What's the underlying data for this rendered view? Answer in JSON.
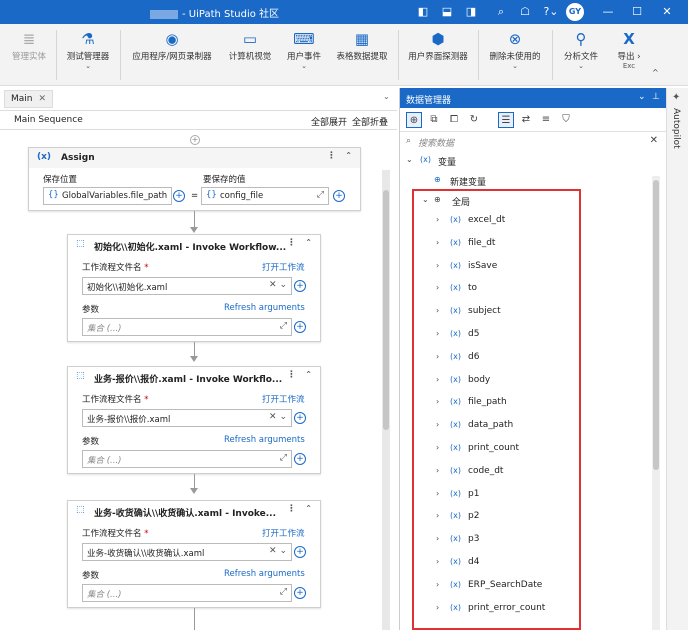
{
  "titlebar": {
    "title": "- UiPath Studio 社区",
    "avatar": "GY"
  },
  "ribbon": {
    "items": [
      {
        "label": "管理实体",
        "icon": "≣",
        "disabled": true,
        "chevron": ""
      },
      {
        "label": "测试管理器",
        "icon": "⚗",
        "disabled": false,
        "chevron": "⌄"
      },
      {
        "label": "应用程序/网页录制器",
        "icon": "◉",
        "disabled": false,
        "chevron": ""
      },
      {
        "label": "计算机视觉",
        "icon": "▭",
        "disabled": false,
        "chevron": ""
      },
      {
        "label": "用户事件",
        "icon": "⌨",
        "disabled": false,
        "chevron": "⌄"
      },
      {
        "label": "表格数据提取",
        "icon": "▦",
        "disabled": false,
        "chevron": ""
      },
      {
        "label": "用户界面探测器",
        "icon": "⬢",
        "disabled": false,
        "chevron": ""
      },
      {
        "label": "删除未使用的",
        "icon": "⊗",
        "disabled": false,
        "chevron": "⌄"
      },
      {
        "label": "分析文件",
        "icon": "⚲",
        "disabled": false,
        "chevron": "⌄"
      },
      {
        "label": "导出 ›",
        "icon": "X",
        "disabled": false,
        "chevron": "Exc"
      }
    ],
    "collapse": "^"
  },
  "editor": {
    "tab_label": "Main",
    "tab_close": "✕",
    "dropdown": "⌄",
    "sequence_name": "Main Sequence",
    "expand_all": "全部展开",
    "collapse_all": "全部折叠",
    "assign": {
      "badge": "(x)",
      "title": "Assign",
      "save_to_label": "保存位置",
      "value_label": "要保存的值",
      "save_to_value": "GlobalVariables.file_path",
      "value_value": "config_file",
      "equals": "="
    },
    "invokes": [
      {
        "title": "初始化\\\\初始化.xaml - Invoke Workflow...",
        "file_label": "工作流程文件名",
        "required": "*",
        "open_link": "打开工作流",
        "file_value": "初始化\\\\初始化.xaml",
        "args_label": "参数",
        "refresh_link": "Refresh arguments",
        "args_placeholder": "集合 (...)"
      },
      {
        "title": "业务-报价\\\\报价.xaml - Invoke Workflo...",
        "file_label": "工作流程文件名",
        "required": "*",
        "open_link": "打开工作流",
        "file_value": "业务-报价\\\\报价.xaml",
        "args_label": "参数",
        "refresh_link": "Refresh arguments",
        "args_placeholder": "集合 (...)"
      },
      {
        "title": "业务-收货确认\\\\收货确认.xaml - Invoke...",
        "file_label": "工作流程文件名",
        "required": "*",
        "open_link": "打开工作流",
        "file_value": "业务-收货确认\\\\收货确认.xaml",
        "args_label": "参数",
        "refresh_link": "Refresh arguments",
        "args_placeholder": "集合 (...)"
      }
    ]
  },
  "data_manager": {
    "title": "数据管理器",
    "search_placeholder": "搜索数据",
    "variables_label": "变量",
    "new_variable": "新建变量",
    "global_label": "全局",
    "variables": [
      "excel_dt",
      "file_dt",
      "isSave",
      "to",
      "subject",
      "d5",
      "d6",
      "body",
      "file_path",
      "data_path",
      "print_count",
      "code_dt",
      "p1",
      "p2",
      "p3",
      "d4",
      "ERP_SearchDate",
      "print_error_count"
    ]
  },
  "autopilot": {
    "label": "Autopilot"
  }
}
